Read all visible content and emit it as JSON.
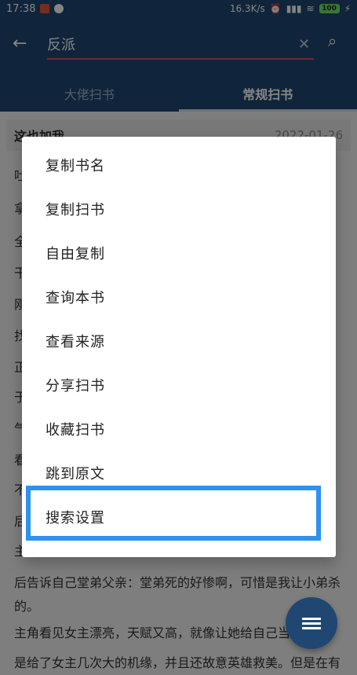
{
  "status_bar": {
    "time": "17:38",
    "network_speed": "16.3K/s",
    "battery": "100"
  },
  "app_bar": {
    "search_value": "反派",
    "tabs": [
      {
        "label": "大佬扫书",
        "active": false
      },
      {
        "label": "常规扫书",
        "active": true
      }
    ]
  },
  "background_content": {
    "card_title": "这也加我",
    "card_date": "2022-01-26",
    "lines": [
      "吐",
      "拿",
      "全",
      "干",
      "刚",
      "找",
      "正",
      "于",
      "气",
      "看",
      "不",
      "后",
      "主",
      "后告诉自己堂弟父亲：堂弟死的好惨啊，可惜是我让小弟杀",
      "的。",
      "主角看见女主漂亮，天赋又高，就像让她给自己当",
      "是给了女主几次大的机缘，并且还故意英雄救美。但是在有"
    ]
  },
  "dialog": {
    "items": [
      {
        "label": "复制书名"
      },
      {
        "label": "复制扫书"
      },
      {
        "label": "自由复制"
      },
      {
        "label": "查询本书"
      },
      {
        "label": "查看来源"
      },
      {
        "label": "分享扫书"
      },
      {
        "label": "收藏扫书"
      },
      {
        "label": "跳到原文"
      },
      {
        "label": "搜索设置"
      }
    ]
  },
  "colors": {
    "primary": "#1f4771",
    "accent": "#d64b6a",
    "highlight": "#2d92f0"
  }
}
